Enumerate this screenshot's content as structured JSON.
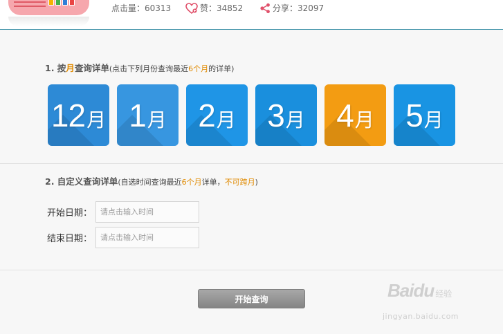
{
  "stats": {
    "views_label": "点击量：",
    "views": "60313",
    "likes_label": "赞：",
    "likes": "34852",
    "shares_label": "分享：",
    "shares": "32097"
  },
  "section1": {
    "num": "1. 按",
    "hl": "月",
    "rest": "查询详单",
    "note_pre": "(点击下列月份查询最近",
    "note_hl": "6个月",
    "note_post": "的详单)"
  },
  "months": [
    {
      "num": "12",
      "unit": "月",
      "color": "#2d8ad6",
      "selected": false
    },
    {
      "num": "1",
      "unit": "月",
      "color": "#3796e0",
      "selected": false
    },
    {
      "num": "2",
      "unit": "月",
      "color": "#1f95e6",
      "selected": false
    },
    {
      "num": "3",
      "unit": "月",
      "color": "#1a8fdd",
      "selected": false
    },
    {
      "num": "4",
      "unit": "月",
      "color": "#f39c12",
      "selected": true
    },
    {
      "num": "5",
      "unit": "月",
      "color": "#1994e3",
      "selected": false
    }
  ],
  "section2": {
    "title": "2. 自定义查询详单",
    "note_pre": "(自选时间查询最近",
    "note_hl1": "6个月",
    "note_mid": "详单，",
    "note_hl2": "不可跨月",
    "note_post": ")"
  },
  "form": {
    "start_label": "开始日期：",
    "end_label": "结束日期：",
    "placeholder": "请点击输入时间"
  },
  "button": {
    "label": "开始查询"
  },
  "watermark": {
    "brand": "Baidu",
    "sub": "经验",
    "url": "jingyan.baidu.com"
  },
  "colors": {
    "accent": "#e08a00",
    "tile_blue": "#1a8fdd",
    "tile_selected": "#f39c12"
  }
}
